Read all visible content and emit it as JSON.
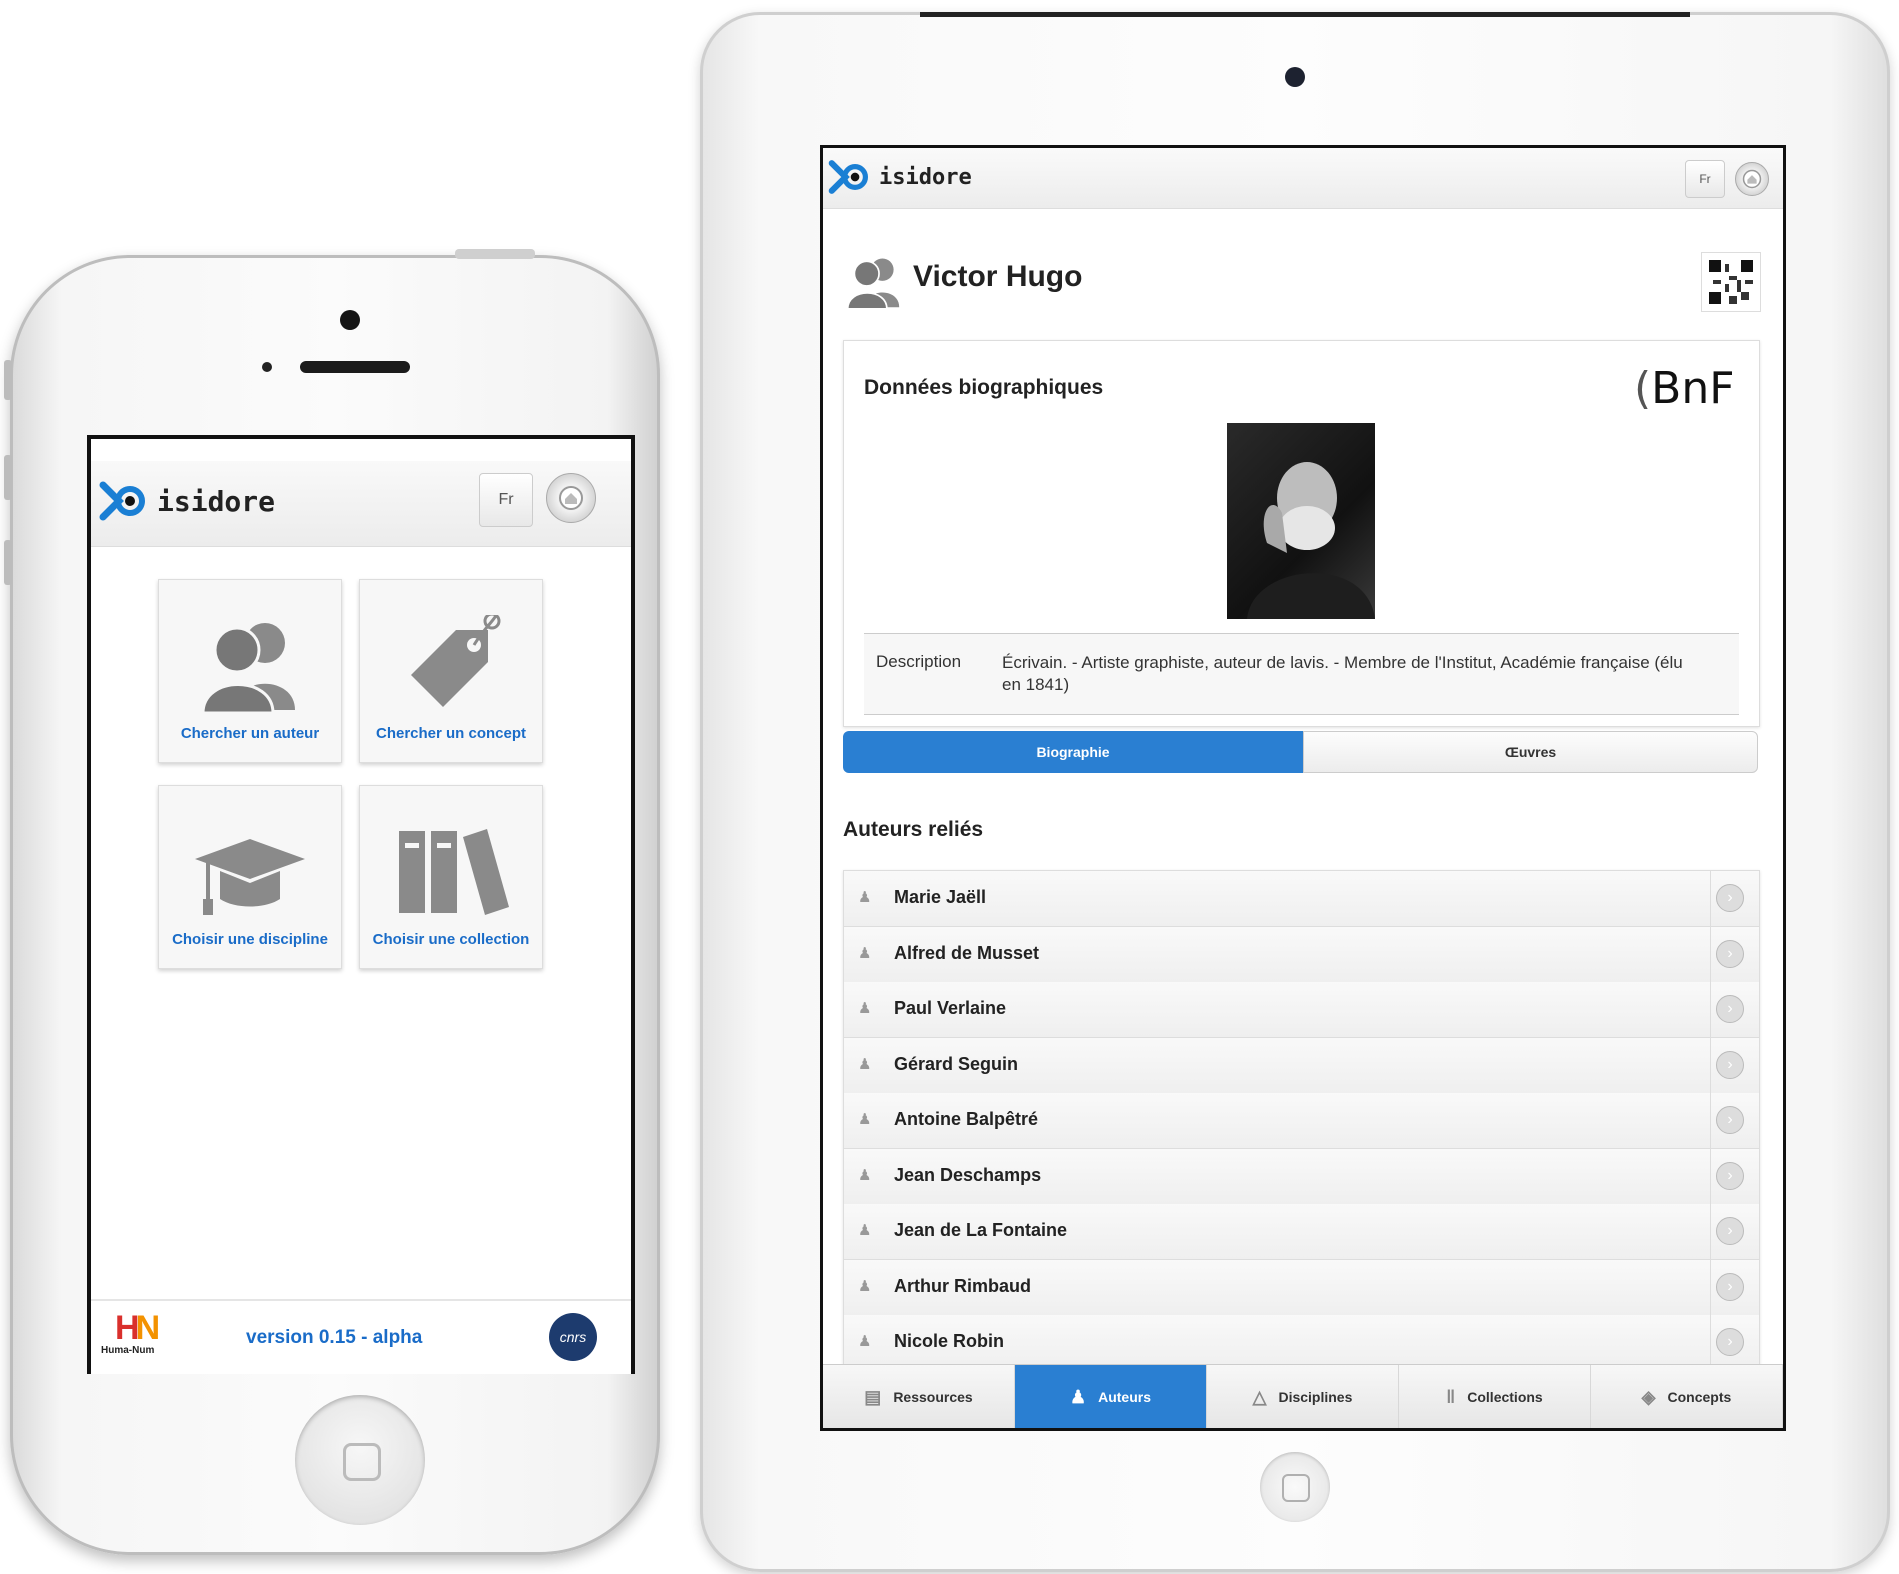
{
  "phone": {
    "brand": "isidore",
    "lang": "Fr",
    "tiles": [
      {
        "label": "Chercher un auteur",
        "icon": "users-icon"
      },
      {
        "label": "Chercher un concept",
        "icon": "tag-icon"
      },
      {
        "label": "Choisir une discipline",
        "icon": "graduation-cap-icon"
      },
      {
        "label": "Choisir une collection",
        "icon": "books-icon"
      }
    ],
    "footer": {
      "huma_logo_letters": "HN",
      "huma_logo_text": "Huma-Num",
      "version": "version 0.15 - alpha",
      "cnrs_logo_text": "cnrs"
    }
  },
  "tablet": {
    "brand": "isidore",
    "lang": "Fr",
    "author_name": "Victor Hugo",
    "bio_heading": "Données biographiques",
    "source_logo": "BnF",
    "description_label": "Description",
    "description_text": "Écrivain. - Artiste graphiste, auteur de lavis. - Membre de l'Institut, Académie française (élu en 1841)",
    "tabs": [
      {
        "label": "Biographie",
        "active": true
      },
      {
        "label": "Œuvres",
        "active": false
      }
    ],
    "related_heading": "Auteurs reliés",
    "related_authors": [
      "Marie Jaëll",
      "Alfred de Musset",
      "Paul Verlaine",
      "Gérard Seguin",
      "Antoine Balpêtré",
      "Jean Deschamps",
      "Jean de La Fontaine",
      "Arthur Rimbaud",
      "Nicole Robin"
    ],
    "nav": [
      {
        "label": "Ressources",
        "icon": "document-icon",
        "active": false
      },
      {
        "label": "Auteurs",
        "icon": "users-icon",
        "active": true
      },
      {
        "label": "Disciplines",
        "icon": "graduation-cap-icon",
        "active": false
      },
      {
        "label": "Collections",
        "icon": "books-icon",
        "active": false
      },
      {
        "label": "Concepts",
        "icon": "tag-icon",
        "active": false
      }
    ]
  },
  "colors": {
    "accent": "#2a7fd2",
    "link": "#1a6cc8",
    "logo_blue": "#1a7fd4",
    "huma_red": "#d9302c",
    "huma_orange": "#f39200",
    "cnrs_navy": "#1d3b6e"
  }
}
